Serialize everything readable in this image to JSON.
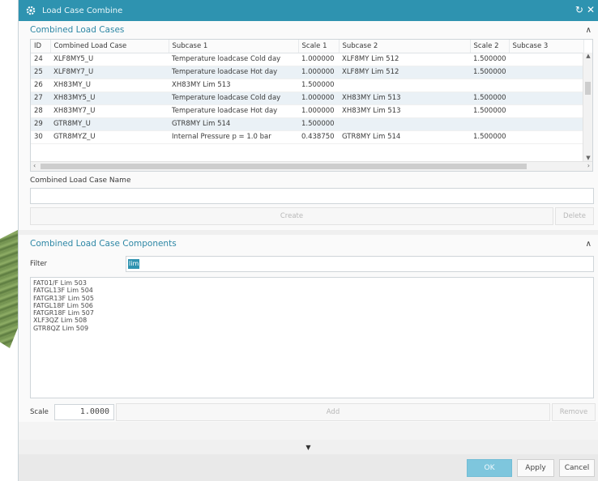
{
  "window": {
    "title": "Load Case Combine",
    "accent_color": "#2e93b0",
    "icons": [
      "gear-icon",
      "reset-icon",
      "close-icon"
    ]
  },
  "combined_group": {
    "title": "Combined Load Cases",
    "columns": [
      "ID",
      "Combined Load Case",
      "Subcase 1",
      "Scale 1",
      "Subcase 2",
      "Scale 2",
      "Subcase 3"
    ],
    "rows": [
      {
        "id": "24",
        "name": "XLF8MY5_U",
        "sub1": "Temperature loadcase Cold day",
        "scale1": "1.000000",
        "sub2": "XLF8MY   Lim 512",
        "scale2": "1.500000",
        "sub3": ""
      },
      {
        "id": "25",
        "name": "XLF8MY7_U",
        "sub1": "Temperature loadcase Hot day",
        "scale1": "1.000000",
        "sub2": "XLF8MY   Lim 512",
        "scale2": "1.500000",
        "sub3": ""
      },
      {
        "id": "26",
        "name": "XH83MY_U",
        "sub1": "XH83MY   Lim 513",
        "scale1": "1.500000",
        "sub2": "",
        "scale2": "",
        "sub3": ""
      },
      {
        "id": "27",
        "name": "XH83MY5_U",
        "sub1": "Temperature loadcase Cold day",
        "scale1": "1.000000",
        "sub2": "XH83MY   Lim 513",
        "scale2": "1.500000",
        "sub3": ""
      },
      {
        "id": "28",
        "name": "XH83MY7_U",
        "sub1": "Temperature loadcase Hot day",
        "scale1": "1.000000",
        "sub2": "XH83MY   Lim 513",
        "scale2": "1.500000",
        "sub3": ""
      },
      {
        "id": "29",
        "name": "GTR8MY_U",
        "sub1": "GTR8MY   Lim 514",
        "scale1": "1.500000",
        "sub2": "",
        "scale2": "",
        "sub3": ""
      },
      {
        "id": "30",
        "name": "GTR8MYZ_U",
        "sub1": "Internal Pressure p = 1.0 bar",
        "scale1": "0.438750",
        "sub2": "GTR8MY   Lim 514",
        "scale2": "1.500000",
        "sub3": ""
      }
    ],
    "name_label": "Combined Load Case Name",
    "name_value": "",
    "create_label": "Create",
    "delete_label": "Delete"
  },
  "components_group": {
    "title": "Combined Load Case Components",
    "filter_label": "Filter",
    "filter_value": "lim",
    "items": [
      "FAT01/F  Lim 503",
      "FATGL13F  Lim 504",
      "FATGR13F  Lim 505",
      "FATGL18F  Lim 506",
      "FATGR18F  Lim 507",
      "XLF3QZ   Lim 508",
      "GTR8QZ   Lim 509"
    ],
    "scale_label": "Scale",
    "scale_value": "1.0000",
    "add_label": "Add",
    "remove_label": "Remove"
  },
  "footer": {
    "ok_label": "OK",
    "apply_label": "Apply",
    "cancel_label": "Cancel"
  }
}
